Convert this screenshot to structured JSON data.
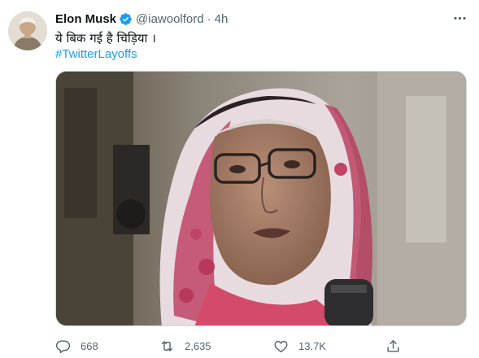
{
  "tweet": {
    "author_name": "Elon Musk",
    "verified": true,
    "handle": "@iawoolford",
    "separator": "·",
    "time": "4h",
    "text": "ये बिक गई है चिड़िया ।",
    "hashtag": "#TwitterLayoffs",
    "media_description": "photo of a woman wearing glasses and a pink and white headscarf",
    "stats": {
      "replies": "668",
      "retweets": "2,635",
      "likes": "13.7K"
    }
  },
  "colors": {
    "text": "#0f1419",
    "secondary": "#536471",
    "accent": "#1d9bf0"
  },
  "icons": [
    "more-icon",
    "verified-icon",
    "reply-icon",
    "retweet-icon",
    "like-icon",
    "share-icon"
  ]
}
